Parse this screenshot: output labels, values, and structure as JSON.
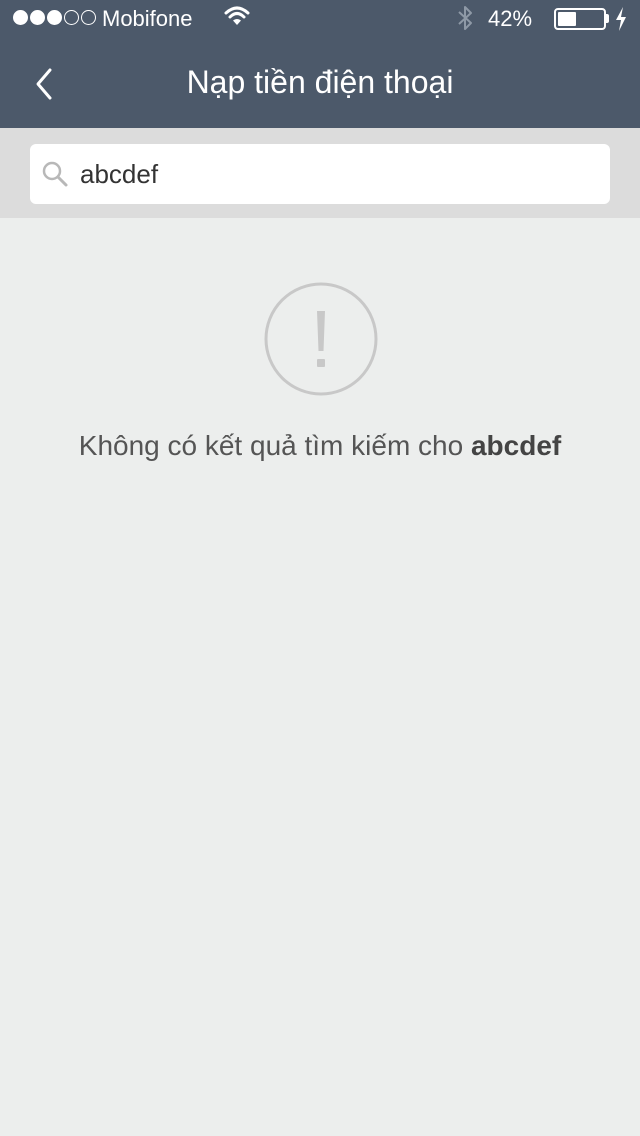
{
  "status_bar": {
    "signal_bars_filled": 3,
    "signal_bars_total": 5,
    "carrier": "Mobifone",
    "wifi_icon": "wifi-icon",
    "bluetooth_icon": "bluetooth-icon",
    "battery_percent_label": "42%",
    "battery_level": 0.42,
    "charging_icon": "charging-bolt-icon"
  },
  "nav": {
    "back_icon": "chevron-left-icon",
    "title": "Nạp tiền điện thoại"
  },
  "search": {
    "icon": "search-icon",
    "value": "abcdef",
    "placeholder": ""
  },
  "empty_state": {
    "icon": "exclamation-circle-icon",
    "message": "Không có kết quả tìm kiếm cho",
    "query": "abcdef"
  },
  "colors": {
    "header_background": "#4c596a",
    "search_area_background": "#dcdcdc",
    "page_background": "#eceeed",
    "icon_gray": "#c8c8c8",
    "text_gray": "#555555"
  }
}
